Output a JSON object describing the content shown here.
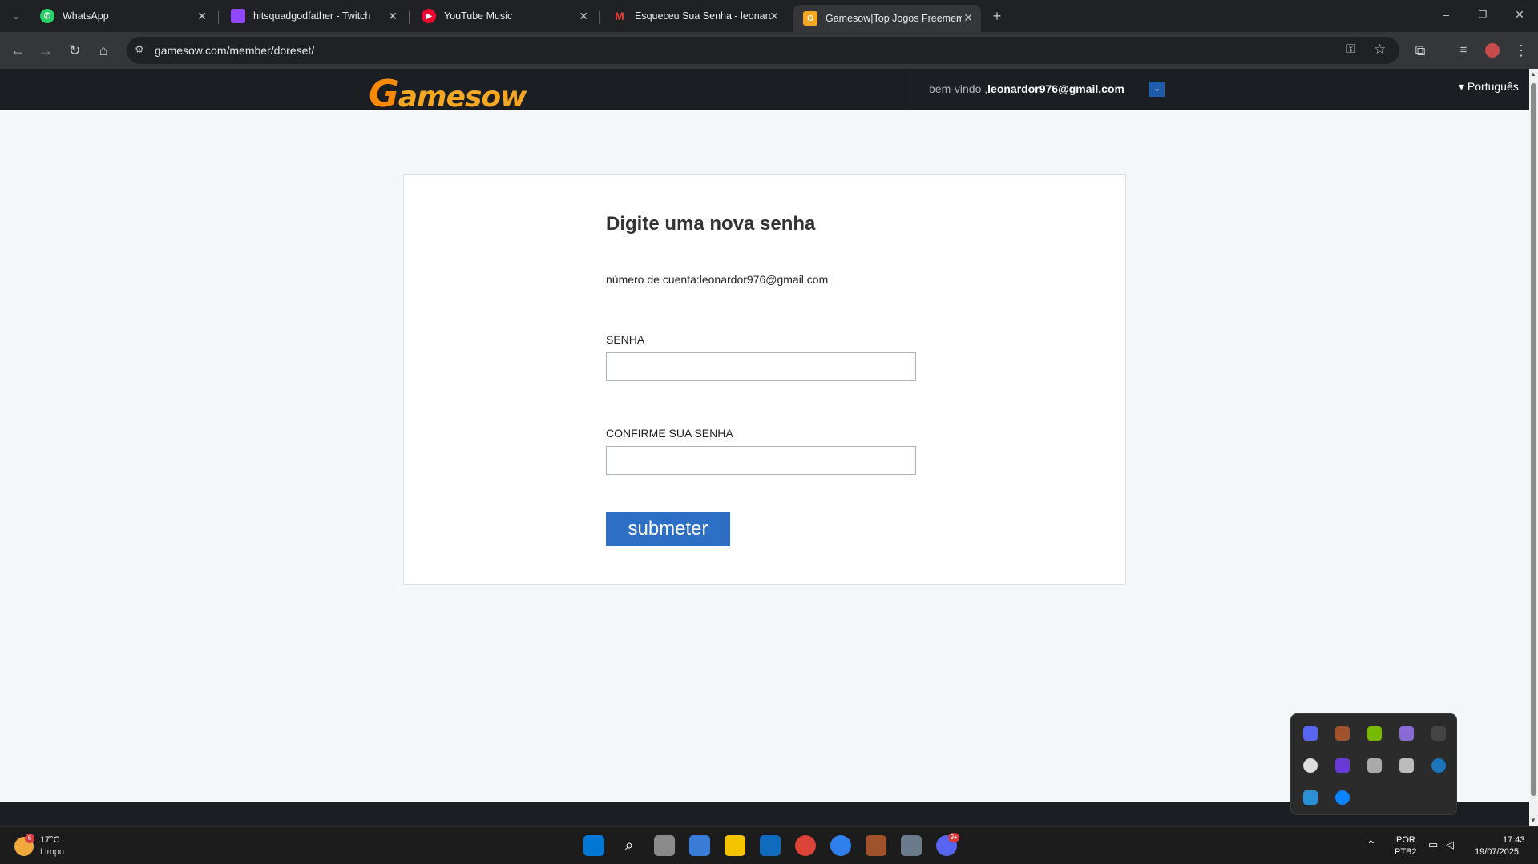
{
  "browser": {
    "tabs": [
      {
        "title": "WhatsApp",
        "icon": "whatsapp-icon",
        "color": "#25d366"
      },
      {
        "title": "hitsquadgodfather - Twitch",
        "icon": "twitch-icon",
        "color": "#9146ff"
      },
      {
        "title": "YouTube Music",
        "icon": "youtube-music-icon",
        "color": "#ff0033"
      },
      {
        "title": "Esqueceu Sua Senha - leonardo",
        "icon": "gmail-icon",
        "color": "#ea4335"
      },
      {
        "title": "Gamesow|Top Jogos Freemem",
        "icon": "gamesow-icon",
        "color": "#f7a823"
      }
    ],
    "url": "gamesow.com/member/doreset/"
  },
  "site": {
    "logo": "Gamesow",
    "welcome": "bem-vindo ,",
    "email": "leonardor976@gmail.com",
    "language": "▾ Português"
  },
  "form": {
    "heading": "Digite uma nova senha",
    "account_line": "número de cuenta:leonardor976@gmail.com",
    "password_label": "SENHA",
    "confirm_label": "CONFIRME SUA SENHA",
    "password_value": "",
    "confirm_value": "",
    "submit_label": "submeter"
  },
  "taskbar": {
    "weather_temp": "17°C",
    "weather_desc": "Limpo",
    "weather_badge": "6",
    "lang_line1": "POR",
    "lang_line2": "PTB2",
    "time": "17:43",
    "date": "19/07/2025",
    "discord_badge": "9+"
  },
  "colors": {
    "accent": "#2d6fc5",
    "header_bg": "#1b1f24",
    "logo": "#f7a823"
  }
}
